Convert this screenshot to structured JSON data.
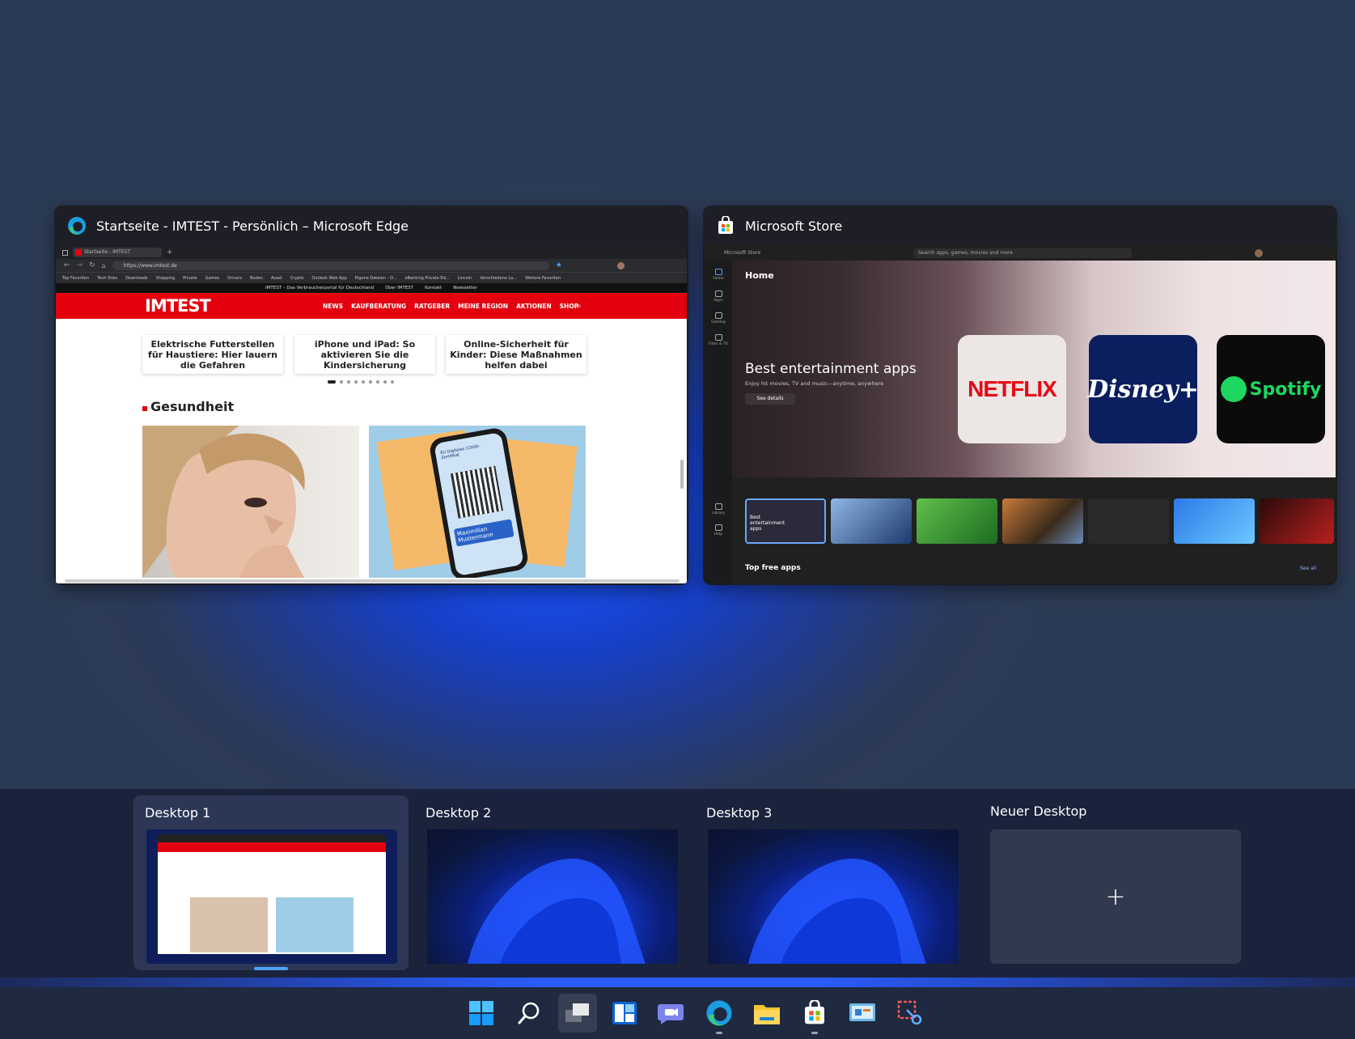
{
  "windows": {
    "edge": {
      "title": "Startseite - IMTEST - Persönlich – Microsoft Edge",
      "tab_label": "Startseite - IMTEST",
      "url": "https://www.imtest.de",
      "favorites": [
        "Top Favoriten",
        "Tech Sites",
        "Downloads",
        "Shopping",
        "Private",
        "Games",
        "Drivers",
        "Boden",
        "Avast",
        "Crypto",
        "Outlook Web App",
        "Eigene Dateien - O...",
        "eBanking Private Ed...",
        "Lincoln",
        "Verschiedene La...",
        "Weitere Favoriten"
      ],
      "topbar": [
        "IMTEST – Das Verbraucherportal für Deutschland",
        "Über IMTEST",
        "Kontakt",
        "Newsletter"
      ],
      "logo": "IMTEST",
      "nav": [
        "NEWS",
        "KAUFBERATUNG",
        "RATGEBER",
        "MEINE REGION",
        "AKTIONEN",
        "SHOP"
      ],
      "cards": [
        "Elektrische Futterstellen für Haustiere: Hier lauern die Gefahren",
        "iPhone und iPad: So aktivieren Sie die Kindersicherung",
        "Online-Sicherheit für Kinder: Diese Maßnahmen helfen dabei"
      ],
      "carousel_active": 1,
      "carousel_count": 9,
      "section": "Gesundheit",
      "cert_label": "EU Digitales COVID-Zertifikat",
      "cert_name": "Maximilian Mustermann"
    },
    "store": {
      "title": "Microsoft Store",
      "app_label": "Microsoft Store",
      "search_placeholder": "Search apps, games, movies and more",
      "home": "Home",
      "side": [
        "Home",
        "Apps",
        "Gaming",
        "Films & TV",
        "Library",
        "Help"
      ],
      "hero_title": "Best entertainment apps",
      "hero_sub": "Enjoy hit movies, TV and music—anytime, anywhere",
      "hero_button": "See details",
      "tiles": [
        "NETFLIX",
        "Disney+",
        "Spotify"
      ],
      "first_thumb": "Best entertainment apps",
      "section": "Top free apps",
      "see_all": "See all"
    }
  },
  "desktops": [
    {
      "label": "Desktop 1",
      "active": true
    },
    {
      "label": "Desktop 2",
      "active": false
    },
    {
      "label": "Desktop 3",
      "active": false
    }
  ],
  "new_desktop": {
    "label": "Neuer Desktop",
    "icon": "plus-icon"
  },
  "taskbar": [
    "start-icon",
    "search-icon",
    "task-view-icon",
    "widgets-icon",
    "chat-icon",
    "edge-icon",
    "file-explorer-icon",
    "store-icon",
    "control-panel-icon",
    "snipping-tool-icon"
  ],
  "colors": {
    "accent": "#1f5bff",
    "imtest_red": "#e3000f",
    "netflix_red": "#e50914",
    "spotify_green": "#1ed760",
    "disney_bg": "#0b1f5f"
  }
}
